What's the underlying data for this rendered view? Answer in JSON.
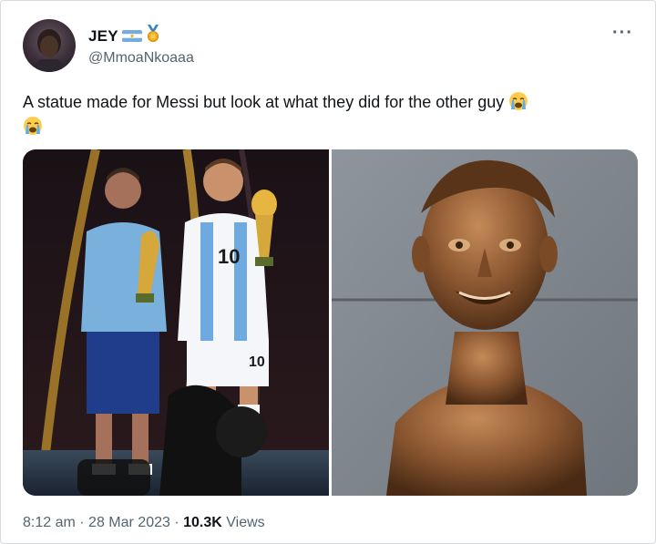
{
  "author": {
    "display_name": "JEY",
    "handle": "@MmoaNkoaaa"
  },
  "tweet": {
    "text": "A statue made for Messi but look at what they did for the other guy",
    "emoji": "loudly-crying-face"
  },
  "media": {
    "left_image": "messi-trophy-statue-photo",
    "right_image": "bronze-bust-photo"
  },
  "footer": {
    "time": "8:12 am",
    "separator": "·",
    "date": "28 Mar 2023",
    "views_count": "10.3K",
    "views_label": "Views"
  },
  "menu": {
    "more_label": "···"
  },
  "colors": {
    "secondary_text": "#536471",
    "primary_text": "#0f1419",
    "border": "#d6dadd"
  }
}
